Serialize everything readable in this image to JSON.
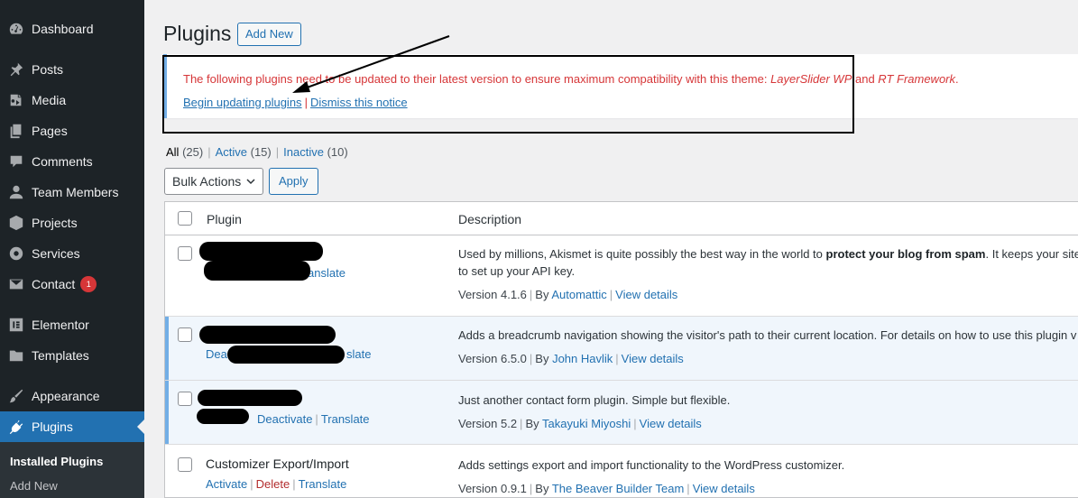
{
  "sidebar": {
    "items": [
      {
        "label": "Dashboard",
        "icon": "dashboard-icon"
      },
      {
        "label": "Posts",
        "icon": "pin-icon"
      },
      {
        "label": "Media",
        "icon": "media-icon"
      },
      {
        "label": "Pages",
        "icon": "pages-icon"
      },
      {
        "label": "Comments",
        "icon": "comment-icon"
      },
      {
        "label": "Team Members",
        "icon": "user-icon"
      },
      {
        "label": "Projects",
        "icon": "portfolio-icon"
      },
      {
        "label": "Services",
        "icon": "life-ring-icon"
      },
      {
        "label": "Contact",
        "icon": "mail-icon",
        "badge": "1"
      },
      {
        "label": "Elementor",
        "icon": "elementor-icon"
      },
      {
        "label": "Templates",
        "icon": "folder-icon"
      },
      {
        "label": "Appearance",
        "icon": "brush-icon"
      },
      {
        "label": "Plugins",
        "icon": "plugin-icon"
      }
    ],
    "submenu": {
      "installed": "Installed Plugins",
      "add_new": "Add New"
    }
  },
  "header": {
    "title": "Plugins",
    "add_new": "Add New"
  },
  "notice": {
    "message_prefix": "The following plugins need to be updated to their latest version to ensure maximum compatibility with this theme: ",
    "plugin_1": "LayerSlider WP",
    "and": " and ",
    "plugin_2": "RT Framework",
    "period": ".",
    "begin_link": "Begin updating plugins",
    "sep": "|",
    "dismiss_link": "Dismiss this notice"
  },
  "filters": {
    "all": {
      "label": "All",
      "count": "(25)"
    },
    "active": {
      "label": "Active",
      "count": "(15)"
    },
    "inactive": {
      "label": "Inactive",
      "count": "(10)"
    },
    "sep": "|"
  },
  "bulk": {
    "label": "Bulk Actions",
    "apply": "Apply"
  },
  "table": {
    "col_plugin": "Plugin",
    "col_description": "Description",
    "rows": [
      {
        "action_fragment": "anslate",
        "desc_1_pre": "Used by millions, Akismet is quite possibly the best way in the world to ",
        "desc_1_bold": "protect your blog from spam",
        "desc_1_post": ". It keeps your site p",
        "desc_2": "to set up your API key.",
        "version": "Version 4.1.6",
        "by": "By",
        "author": "Automattic",
        "details": "View details"
      },
      {
        "action_fragment_a": "Dea",
        "action_fragment_b": "slate",
        "desc_1": "Adds a breadcrumb navigation showing the visitor's path to their current location. For details on how to use this plugin v",
        "version": "Version 6.5.0",
        "by": "By",
        "author": "John Havlik",
        "details": "View details"
      },
      {
        "deactivate": "Deactivate",
        "translate": "Translate",
        "desc_1": "Just another contact form plugin. Simple but flexible.",
        "version": "Version 5.2",
        "by": "By",
        "author": "Takayuki Miyoshi",
        "details": "View details"
      },
      {
        "name": "Customizer Export/Import",
        "activate": "Activate",
        "delete": "Delete",
        "translate": "Translate",
        "desc_1": "Adds settings export and import functionality to the WordPress customizer.",
        "version": "Version 0.9.1",
        "by": "By",
        "author": "The Beaver Builder Team",
        "details": "View details"
      }
    ]
  },
  "colors": {
    "accent": "#2271b1",
    "sidebar": "#1d2327",
    "error": "#d63638",
    "active_row": "#f0f6fc"
  }
}
